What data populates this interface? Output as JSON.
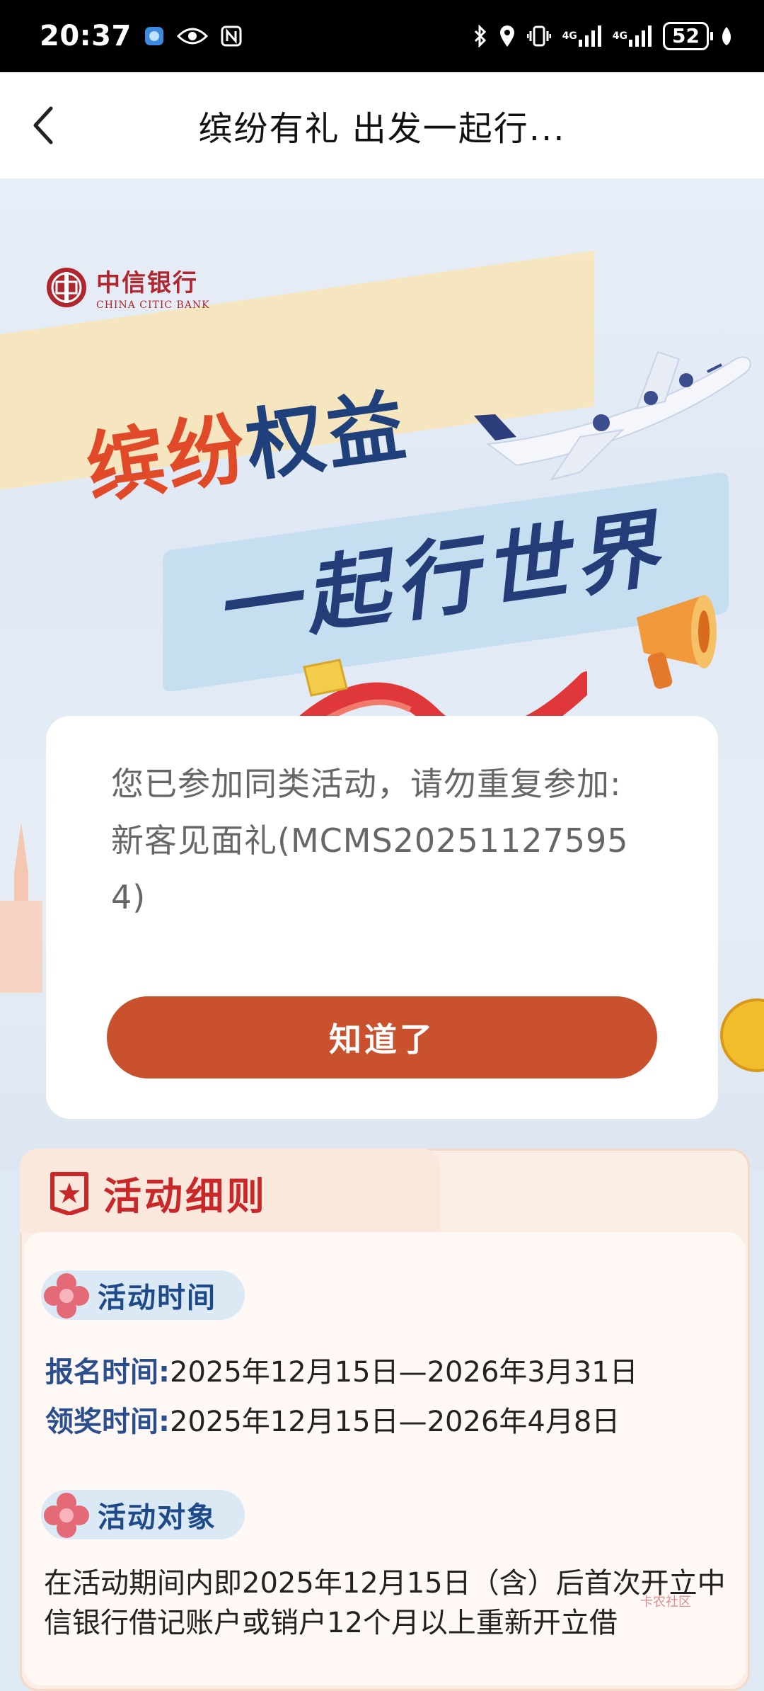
{
  "status_bar": {
    "time": "20:37",
    "signal_1": "4G",
    "signal_2": "4G",
    "battery": "52"
  },
  "header": {
    "title": "缤纷有礼 出发一起行..."
  },
  "banner": {
    "bank_name_cn": "中信银行",
    "bank_name_en": "CHINA CITIC BANK",
    "slogan_line1_red": "缤纷",
    "slogan_line1_blue": "权益",
    "slogan_line2": "一起行世界"
  },
  "dialog": {
    "message": "您已参加同类活动，请勿重复参加:新客见面礼(MCMS202511275954)",
    "ok_label": "知道了"
  },
  "rules": {
    "title": "活动细则",
    "time_section": {
      "label": "活动时间",
      "signup_key": "报名时间:",
      "signup_value": "2025年12月15日—2026年3月31日",
      "claim_key": "领奖时间:",
      "claim_value": "2025年12月15日—2026年4月8日"
    },
    "target_section": {
      "label": "活动对象",
      "text": "在活动期间内即2025年12月15日（含）后首次开立中信银行借记账户或销户12个月以上重新开立借"
    }
  },
  "watermark": "卡农社区",
  "colors": {
    "accent_button": "#c9512d",
    "rules_title": "#c9282a",
    "slogan_blue": "#20407c",
    "slogan_red": "#e04a28"
  },
  "icons": [
    "back-arrow-icon",
    "bluetooth-icon",
    "location-icon",
    "vibrate-icon",
    "eye-icon",
    "nfc-icon",
    "rules-icon",
    "flower-icon"
  ]
}
